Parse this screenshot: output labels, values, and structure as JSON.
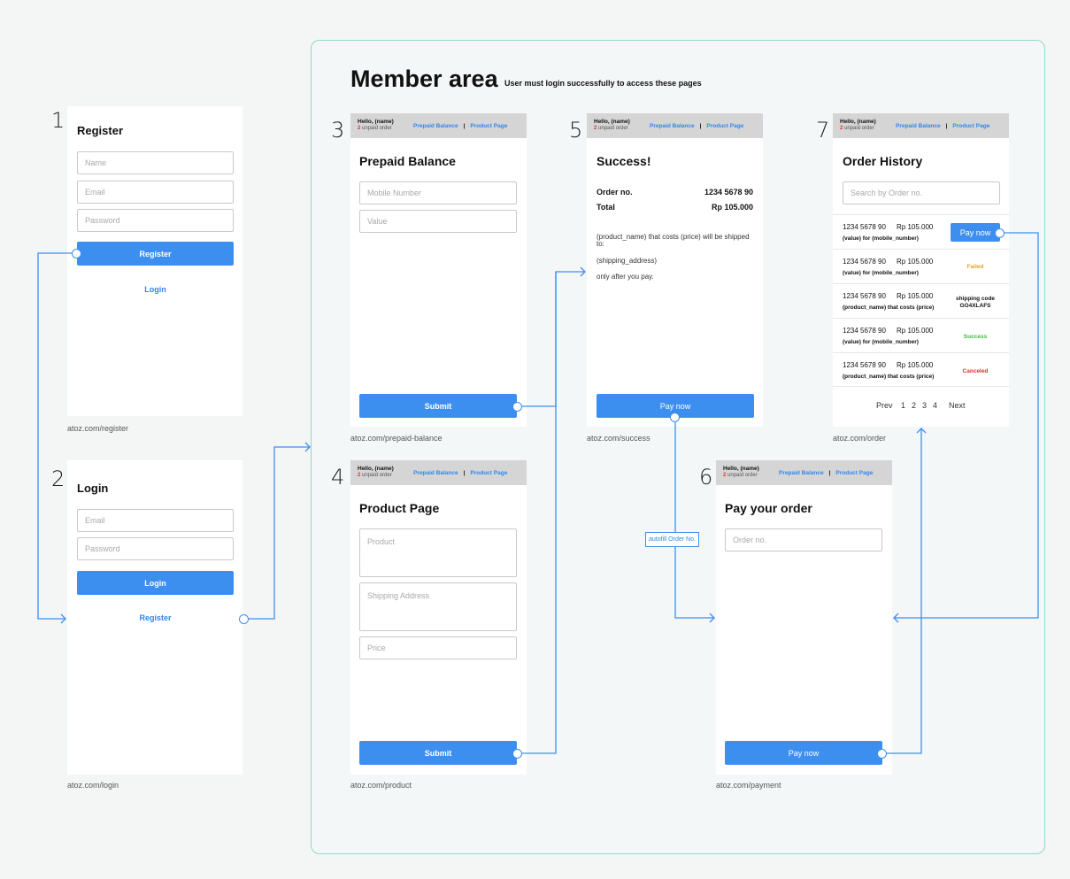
{
  "member_area": {
    "title": "Member area",
    "subtitle": "User must login successfully to access these pages"
  },
  "topbar": {
    "hello": "Hello, (name)",
    "unpaid_count": "2",
    "unpaid_label": "unpaid order",
    "link_prepaid": "Prepaid Balance",
    "link_separator": "|",
    "link_product": "Product Page"
  },
  "register": {
    "number": "1",
    "title": "Register",
    "name_placeholder": "Name",
    "email_placeholder": "Email",
    "password_placeholder": "Password",
    "button": "Register",
    "login_link": "Login",
    "url": "atoz.com/register"
  },
  "login": {
    "number": "2",
    "title": "Login",
    "email_placeholder": "Email",
    "password_placeholder": "Password",
    "button": "Login",
    "register_link": "Register",
    "url": "atoz.com/login"
  },
  "prepaid": {
    "number": "3",
    "title": "Prepaid Balance",
    "mobile_placeholder": "Mobile Number",
    "value_placeholder": "Value",
    "button": "Submit",
    "url": "atoz.com/prepaid-balance"
  },
  "product": {
    "number": "4",
    "title": "Product Page",
    "product_placeholder": "Product",
    "address_placeholder": "Shipping Address",
    "price_placeholder": "Price",
    "button": "Submit",
    "url": "atoz.com/product"
  },
  "success": {
    "number": "5",
    "title": "Success!",
    "order_label": "Order no.",
    "order_value": "1234 5678 90",
    "total_label": "Total",
    "total_value": "Rp 105.000",
    "message_line1": "(product_name) that costs (price) will be shipped",
    "message_line2": "to:",
    "message_line3": "(shipping_address)",
    "message_line4": "only after you pay.",
    "button": "Pay now",
    "url": "atoz.com/success"
  },
  "payment": {
    "number": "6",
    "title": "Pay your order",
    "order_placeholder": "Order no.",
    "button": "Pay now",
    "url": "atoz.com/payment"
  },
  "orders": {
    "number": "7",
    "title": "Order History",
    "search_placeholder": "Search by Order no.",
    "rows": [
      {
        "order_no": "1234 5678 90",
        "amount": "Rp 105.000",
        "desc": "(value) for (mobile_number)",
        "status": "Pay now",
        "status_kind": "button"
      },
      {
        "order_no": "1234 5678 90",
        "amount": "Rp 105.000",
        "desc": "(value) for (mobile_number)",
        "status": "Failed",
        "status_kind": "failed"
      },
      {
        "order_no": "1234 5678 90",
        "amount": "Rp 105.000",
        "desc": "(product_name) that costs (price)",
        "status": "shipping code",
        "status2": "GO4XLAFS",
        "status_kind": "shipping"
      },
      {
        "order_no": "1234 5678 90",
        "amount": "Rp 105.000",
        "desc": "(value) for (mobile_number)",
        "status": "Success",
        "status_kind": "success"
      },
      {
        "order_no": "1234 5678 90",
        "amount": "Rp 105.000",
        "desc": "(product_name) that costs (price)",
        "status": "Canceled",
        "status_kind": "canceled"
      }
    ],
    "pagination": {
      "prev": "Prev",
      "pages": [
        "1",
        "2",
        "3",
        "4"
      ],
      "next": "Next"
    },
    "url": "atoz.com/order"
  },
  "autofill_label": "autofill Order No.",
  "colors": {
    "accent": "#3d8fef",
    "member_border": "#8fd9c2",
    "failed": "#f0a020",
    "success": "#3cba3c",
    "canceled": "#e0312b",
    "unpaid": "#e0312b"
  }
}
